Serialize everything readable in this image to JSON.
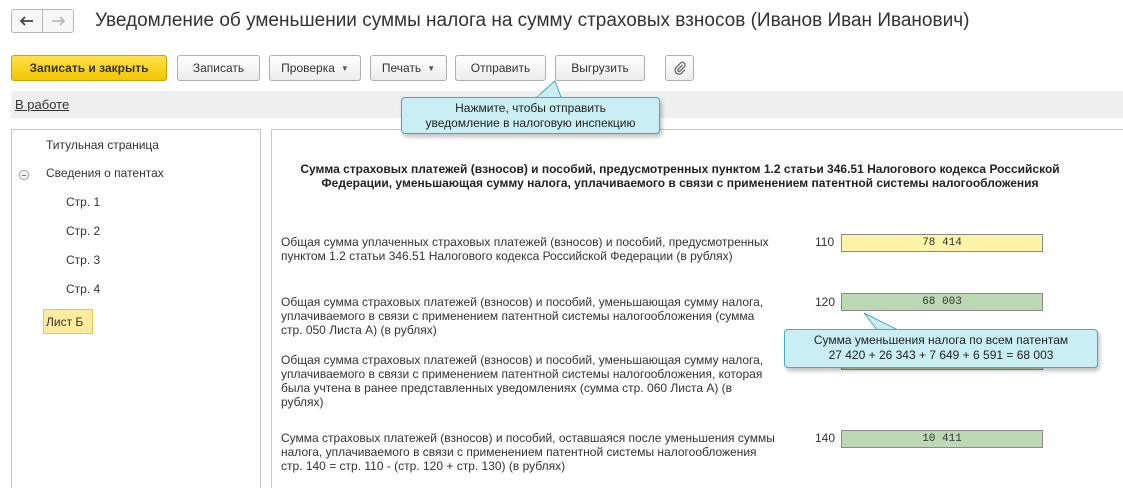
{
  "window": {
    "title": "Уведомление об уменьшении суммы налога на сумму страховых взносов (Иванов Иван Иванович)"
  },
  "toolbar": {
    "save_close": "Записать и закрыть",
    "save": "Записать",
    "check": "Проверка",
    "print": "Печать",
    "send": "Отправить",
    "export": "Выгрузить"
  },
  "icons": {
    "back": "arrow-left-icon",
    "forward": "arrow-right-icon",
    "attach": "paperclip-icon",
    "dropdown": "triangle-down-icon"
  },
  "status": {
    "link": "В работе"
  },
  "callouts": {
    "send_line1": "Нажмите, чтобы отправить",
    "send_line2": "уведомление в налоговую инспекцию",
    "sum_line1": "Сумма уменьшения налога по всем патентам",
    "sum_line2": "27 420 + 26 343 + 7 649 + 6 591 = 68 003"
  },
  "tree": {
    "title_page": "Титульная страница",
    "patents": "Сведения о патентах",
    "page1": "Стр. 1",
    "page2": "Стр. 2",
    "page3": "Стр. 3",
    "page4": "Стр. 4",
    "sheet_b": "Лист Б"
  },
  "section": {
    "heading": "Сумма страховых платежей (взносов) и пособий, предусмотренных пунктом 1.2 статьи 346.51 Налогового кодекса Российской Федерации, уменьшающая сумму налога, уплачиваемого в связи с применением патентной системы налогообложения"
  },
  "rows": [
    {
      "label": "Общая сумма уплаченных страховых платежей (взносов) и пособий, предусмотренных пунктом 1.2 статьи 346.51 Налогового кодекса Российской Федерации (в рублях)",
      "code": "110",
      "value": "78 414"
    },
    {
      "label": "Общая сумма страховых платежей (взносов) и пособий, уменьшающая сумму налога, уплачиваемого в связи с применением патентной системы налогообложения (сумма стр. 050 Листа А) (в рублях)",
      "code": "120",
      "value": "68 003"
    },
    {
      "label": "Общая сумма страховых платежей (взносов) и пособий, уменьшающая сумму налога, уплачиваемого в связи с применением патентной системы налогообложения, которая была учтена в ранее представленных уведомлениях (сумма стр. 060 Листа А) (в рублях)",
      "code": "",
      "value": ""
    },
    {
      "label": "Сумма страховых платежей (взносов) и пособий, оставшаяся после уменьшения суммы налога, уплачиваемого в связи с применением патентной системы налогообложения стр. 140 = стр. 110 - (стр. 120 + стр. 130) (в рублях)",
      "code": "140",
      "value": "10 411"
    }
  ],
  "colors": {
    "primary_button": "#f3c600",
    "callout_bg": "#c9eef4",
    "callout_border": "#49a9bb",
    "field_yellow": "#fbf3a6",
    "field_green": "#bcd8b4",
    "tree_selected": "#fbeb9c"
  }
}
